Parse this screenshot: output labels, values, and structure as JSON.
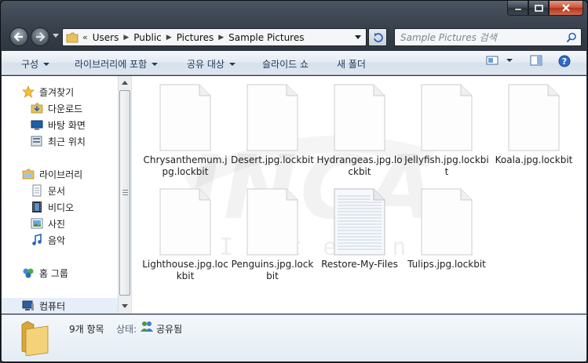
{
  "window": {
    "controls": {
      "minimize": "minimize-icon",
      "maximize": "maximize-icon",
      "close": "close-icon"
    }
  },
  "address": {
    "overflow_chevron": "«",
    "crumbs": [
      "Users",
      "Public",
      "Pictures",
      "Sample Pictures"
    ]
  },
  "search": {
    "placeholder": "Sample Pictures 검색"
  },
  "toolbar": {
    "organize": "구성",
    "add_to_library": "라이브러리에 포함",
    "share_with": "공유 대상",
    "slide_show": "슬라이드 쇼",
    "new_folder": "새 폴더"
  },
  "sidebar": {
    "favorites": "즐겨찾기",
    "downloads": "다운로드",
    "desktop": "바탕 화면",
    "recent": "최근 위치",
    "libraries": "라이브러리",
    "documents": "문서",
    "videos": "비디오",
    "pictures": "사진",
    "music": "음악",
    "homegroup": "홈 그룹",
    "computer": "컴퓨터"
  },
  "files": [
    {
      "name": "Chrysanthemum.jpg.lockbit",
      "type": "blank"
    },
    {
      "name": "Desert.jpg.lockbit",
      "type": "blank"
    },
    {
      "name": "Hydrangeas.jpg.lockbit",
      "type": "blank"
    },
    {
      "name": "Jellyfish.jpg.lockbit",
      "type": "blank"
    },
    {
      "name": "Koala.jpg.lockbit",
      "type": "blank"
    },
    {
      "name": "Lighthouse.jpg.lockbit",
      "type": "blank"
    },
    {
      "name": "Penguins.jpg.lockbit",
      "type": "blank"
    },
    {
      "name": "Restore-My-Files",
      "type": "text"
    },
    {
      "name": "Tulips.jpg.lockbit",
      "type": "blank"
    }
  ],
  "watermark": {
    "logo": "INCA",
    "sub": "Internet"
  },
  "status": {
    "count": "9개 항목",
    "state_label": "상태:",
    "state_value": "공유됨"
  },
  "colors": {
    "frame": "#2f3741",
    "toolbar_text": "#1e395b",
    "close_button": "#c7523a"
  }
}
